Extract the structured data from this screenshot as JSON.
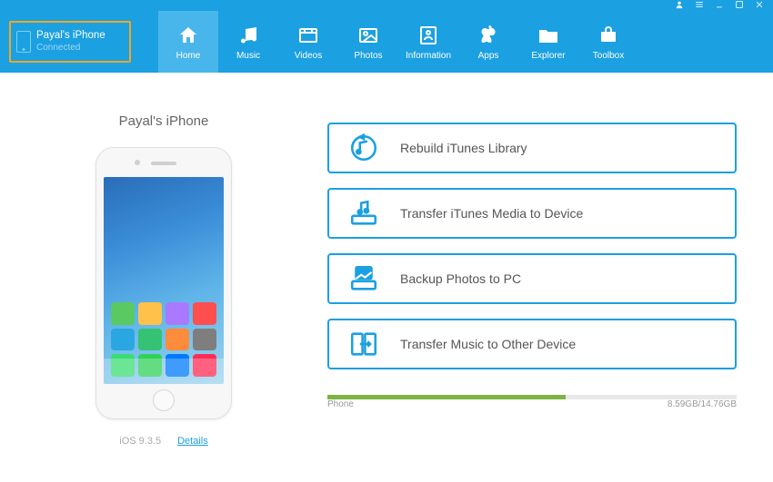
{
  "titlebar": {
    "icons": [
      "user-icon",
      "menu-icon",
      "minimize-icon",
      "maximize-icon",
      "close-icon"
    ]
  },
  "device": {
    "name": "Payal's iPhone",
    "status": "Connected"
  },
  "nav": [
    {
      "label": "Home",
      "active": true
    },
    {
      "label": "Music",
      "active": false
    },
    {
      "label": "Videos",
      "active": false
    },
    {
      "label": "Photos",
      "active": false
    },
    {
      "label": "Information",
      "active": false
    },
    {
      "label": "Apps",
      "active": false
    },
    {
      "label": "Explorer",
      "active": false
    },
    {
      "label": "Toolbox",
      "active": false
    }
  ],
  "phone": {
    "title": "Payal's iPhone",
    "os_version": "iOS 9.3.5",
    "details_link": "Details"
  },
  "actions": [
    {
      "label": "Rebuild iTunes Library"
    },
    {
      "label": "Transfer iTunes Media to Device"
    },
    {
      "label": "Backup Photos to PC"
    },
    {
      "label": "Transfer Music to Other Device"
    }
  ],
  "storage": {
    "label": "Phone",
    "used_gb": 8.59,
    "total_gb": 14.76,
    "display": "8.59GB/14.76GB",
    "percent": 58.2
  },
  "app_colors": [
    "#5ac961",
    "#ffc14a",
    "#a97aff",
    "#ff4e4e",
    "#2aa7e0",
    "#36c275",
    "#ff8b3d",
    "#7e7e7e",
    "#3bdc72",
    "#30d158",
    "#007aff",
    "#ff2d55"
  ]
}
